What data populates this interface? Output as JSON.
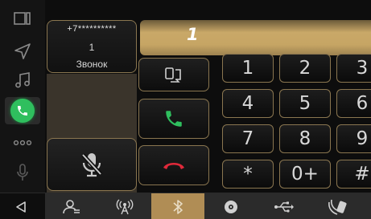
{
  "caller": {
    "number": "+7**********",
    "count": "1",
    "label": "Звонок"
  },
  "dial_entry": "1",
  "keypad": [
    {
      "label": "1",
      "name": "key-1"
    },
    {
      "label": "2",
      "name": "key-2"
    },
    {
      "label": "3",
      "name": "key-3"
    },
    {
      "label": "4",
      "name": "key-4"
    },
    {
      "label": "5",
      "name": "key-5"
    },
    {
      "label": "6",
      "name": "key-6"
    },
    {
      "label": "7",
      "name": "key-7"
    },
    {
      "label": "8",
      "name": "key-8"
    },
    {
      "label": "9",
      "name": "key-9"
    },
    {
      "label": "*",
      "name": "key-star"
    },
    {
      "label": "0+",
      "name": "key-0"
    },
    {
      "label": "#",
      "name": "key-hash"
    }
  ],
  "sidebar": [
    "screen-mode-icon",
    "navigation-icon",
    "music-icon",
    "phone-icon",
    "more-icon",
    "voice-icon"
  ],
  "bottom_tabs": [
    "contacts-icon",
    "radio-icon",
    "bluetooth-icon",
    "disc-icon",
    "usb-icon",
    "phone-connect-icon"
  ],
  "active_tab": "bluetooth-icon",
  "colors": {
    "accent": "#b08d55",
    "call_green": "#2fbf5e",
    "end_red": "#e0293a",
    "border": "#8a7650"
  }
}
